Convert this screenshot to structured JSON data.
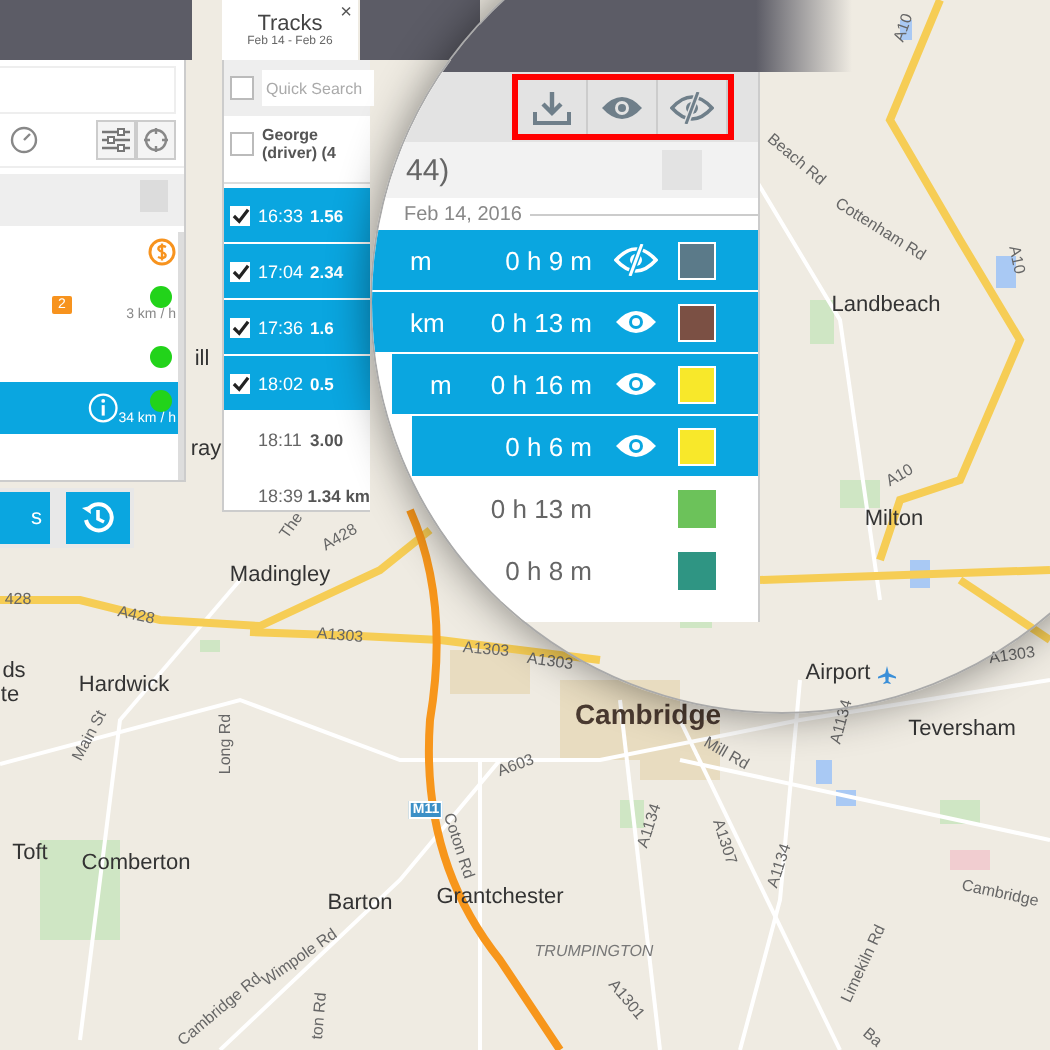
{
  "left_panel": {
    "rows": [
      {
        "selected": false,
        "kind": "money"
      },
      {
        "selected": false,
        "kind": "online",
        "badge": "2",
        "speed": "3 km / h"
      },
      {
        "selected": false,
        "kind": "online"
      },
      {
        "selected": true,
        "kind": "online",
        "speed": "34 km / h"
      }
    ],
    "button_label": "s"
  },
  "tracks": {
    "tab": {
      "title": "Tracks",
      "dates": "Feb 14 - Feb 26",
      "close": "×"
    },
    "search": {
      "placeholder": "Quick Search",
      "checked": false
    },
    "group": {
      "name": "George (driver) (4",
      "checked": false
    },
    "rows": [
      {
        "time": "16:33",
        "distance": "1.56",
        "selected": true
      },
      {
        "time": "17:04",
        "distance": "2.34",
        "selected": true
      },
      {
        "time": "17:36",
        "distance": "1.6",
        "selected": true
      },
      {
        "time": "18:02",
        "distance": "0.5",
        "selected": true
      },
      {
        "time": "18:11",
        "distance": "3.00",
        "selected": false
      },
      {
        "time": "18:39",
        "distance": "1.34 km",
        "selected": false
      }
    ]
  },
  "magnifier": {
    "count": "44)",
    "date": "Feb 14, 2016",
    "rows": [
      {
        "fragment": "m",
        "duration": "0 h 9 m",
        "selected": true,
        "visible": false,
        "color": "#5b7a89"
      },
      {
        "fragment": "km",
        "duration": "0 h 13 m",
        "selected": true,
        "visible": true,
        "color": "#7b5044"
      },
      {
        "fragment": "m",
        "duration": "0 h 16 m",
        "selected": true,
        "visible": true,
        "color": "#f8e82a"
      },
      {
        "fragment": "",
        "duration": "0 h 6 m",
        "selected": true,
        "visible": true,
        "color": "#f8e82a"
      },
      {
        "fragment": "",
        "duration": "0 h 13 m",
        "selected": false,
        "visible": false,
        "color": "#6cc25a"
      },
      {
        "fragment": "",
        "duration": "0 h 8 m",
        "selected": false,
        "visible": false,
        "color": "#2f9583"
      }
    ]
  },
  "map": {
    "labels": [
      {
        "text": "A10",
        "kind": "road"
      },
      {
        "text": "Beach Rd",
        "kind": "road"
      },
      {
        "text": "Cottenham Rd",
        "kind": "road"
      },
      {
        "text": "A10",
        "kind": "road"
      },
      {
        "text": "Landbeach",
        "kind": "village"
      },
      {
        "text": "ill",
        "kind": "village"
      },
      {
        "text": "ray",
        "kind": "village"
      },
      {
        "text": "A10",
        "kind": "road"
      },
      {
        "text": "Milton",
        "kind": "village"
      },
      {
        "text": "The",
        "kind": "road"
      },
      {
        "text": "A428",
        "kind": "road"
      },
      {
        "text": "Madingley",
        "kind": "village"
      },
      {
        "text": "428",
        "kind": "road"
      },
      {
        "text": "A428",
        "kind": "road"
      },
      {
        "text": "A1303",
        "kind": "road"
      },
      {
        "text": "A1303",
        "kind": "road"
      },
      {
        "text": "A1303",
        "kind": "road"
      },
      {
        "text": "A1303",
        "kind": "road"
      },
      {
        "text": "ds",
        "kind": "village"
      },
      {
        "text": "Airport",
        "kind": "village"
      },
      {
        "text": "Hardwick",
        "kind": "village"
      },
      {
        "text": "te",
        "kind": "village"
      },
      {
        "text": "Cambridge",
        "kind": "city"
      },
      {
        "text": "A1134",
        "kind": "road"
      },
      {
        "text": "Teversham",
        "kind": "village"
      },
      {
        "text": "Main St",
        "kind": "road"
      },
      {
        "text": "Long Rd",
        "kind": "road"
      },
      {
        "text": "Mill Rd",
        "kind": "road"
      },
      {
        "text": "A603",
        "kind": "road"
      },
      {
        "text": "M11",
        "kind": "shield"
      },
      {
        "text": "A1134",
        "kind": "road"
      },
      {
        "text": "A1307",
        "kind": "road"
      },
      {
        "text": "Coton Rd",
        "kind": "road"
      },
      {
        "text": "Toft",
        "kind": "village"
      },
      {
        "text": "Comberton",
        "kind": "village"
      },
      {
        "text": "A1134",
        "kind": "road"
      },
      {
        "text": "Cambridge",
        "kind": "road"
      },
      {
        "text": "Grantchester",
        "kind": "village"
      },
      {
        "text": "Barton",
        "kind": "village"
      },
      {
        "text": "TRUMPINGTON",
        "kind": "district"
      },
      {
        "text": "Wimpole Rd",
        "kind": "road"
      },
      {
        "text": "Limekiln Rd",
        "kind": "road"
      },
      {
        "text": "A1301",
        "kind": "road"
      },
      {
        "text": "Cambridge Rd",
        "kind": "road"
      },
      {
        "text": "ton Rd",
        "kind": "road"
      },
      {
        "text": "Ba",
        "kind": "road"
      }
    ]
  }
}
